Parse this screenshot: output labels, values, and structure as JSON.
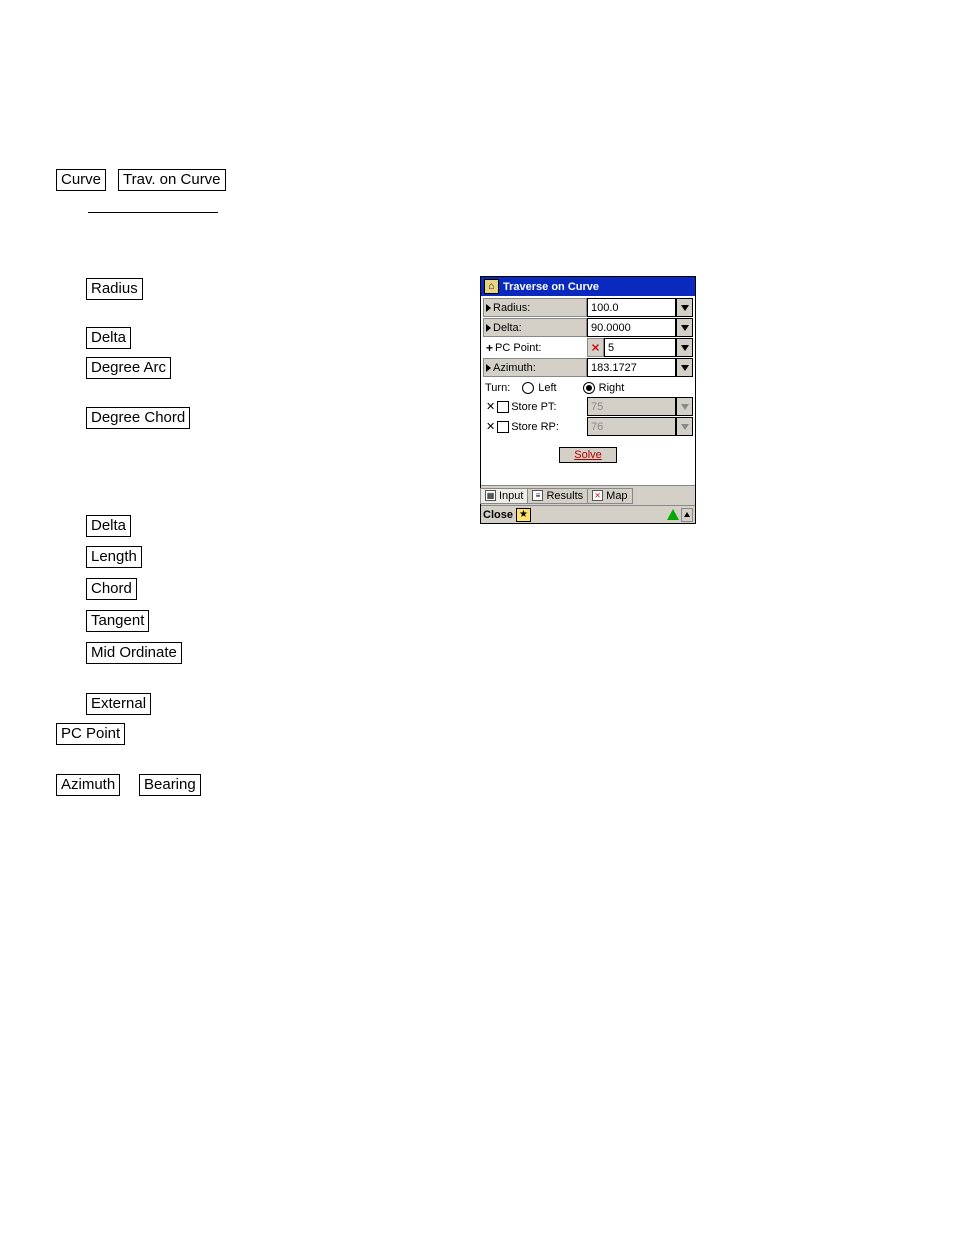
{
  "buttons": {
    "curve": "Curve",
    "trav_on_curve": "Trav. on Curve",
    "radius": "Radius",
    "delta1": "Delta",
    "degree_arc": "Degree Arc",
    "degree_chord": "Degree Chord",
    "delta2": "Delta",
    "length": "Length",
    "chord": "Chord",
    "tangent": "Tangent",
    "mid_ordinate": "Mid Ordinate",
    "external": "External",
    "pc_point": "PC Point",
    "azimuth": "Azimuth",
    "bearing": "Bearing"
  },
  "dialog": {
    "title": "Traverse on Curve",
    "rows": {
      "radius_label": "Radius:",
      "radius_value": "100.0",
      "delta_label": "Delta:",
      "delta_value": "90.0000",
      "pcpoint_label": "PC Point:",
      "pcpoint_value": "5",
      "azimuth_label": "Azimuth:",
      "azimuth_value": "183.1727"
    },
    "turn": {
      "label": "Turn:",
      "left": "Left",
      "right": "Right",
      "selected": "right"
    },
    "store_pt": {
      "label": "Store PT:",
      "value": "75"
    },
    "store_rp": {
      "label": "Store RP:",
      "value": "76"
    },
    "solve": "Solve",
    "tabs": {
      "input": "Input",
      "results": "Results",
      "map": "Map"
    },
    "status": {
      "close": "Close"
    }
  }
}
